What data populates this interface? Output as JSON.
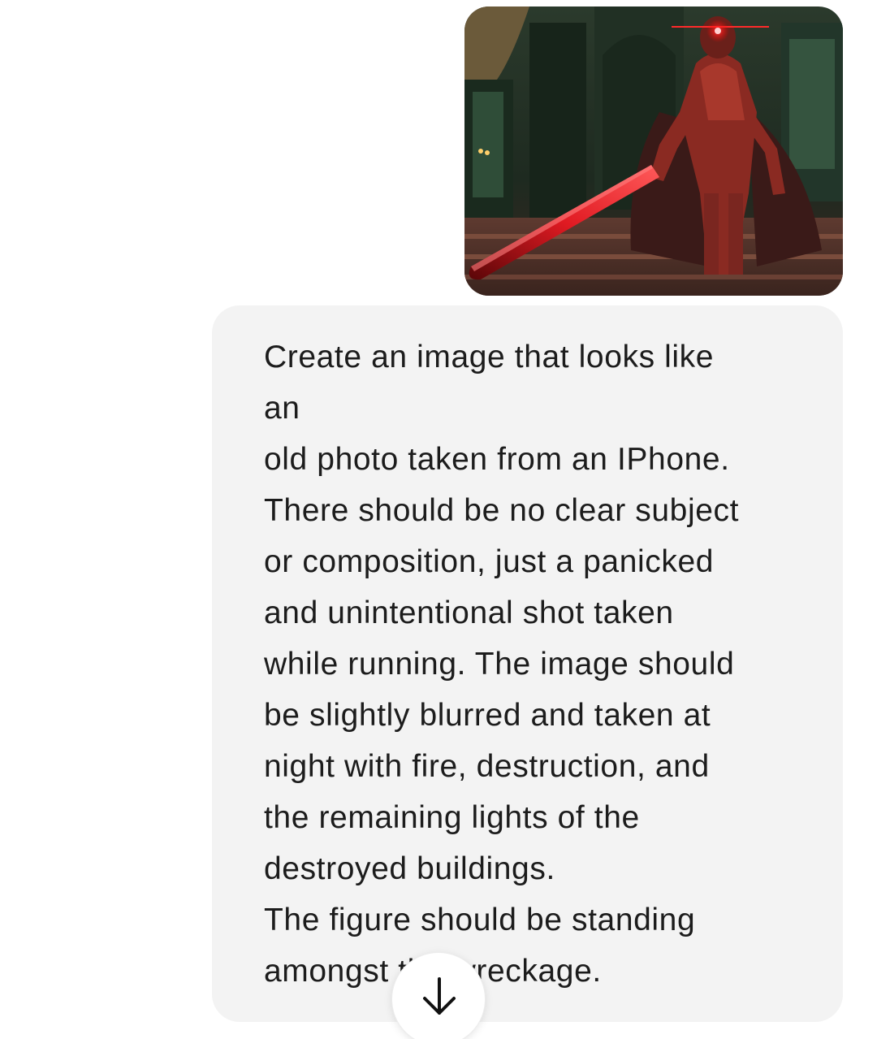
{
  "message": {
    "attachment_icon": "image-attachment",
    "lines": [
      "Create an image that looks like",
      "an",
      "old photo taken from an IPhone.",
      "There should be no clear subject",
      "or composition, just a panicked",
      "and unintentional shot taken",
      "while running. The image should",
      "be slightly blurred and taken at",
      "night with fire, destruction, and",
      "the remaining lights of the",
      "destroyed buildings.",
      "The figure should be standing",
      "amongst the wreckage."
    ]
  },
  "scroll_button": {
    "icon": "arrow-down-icon"
  },
  "colors": {
    "bubble_background": "#f3f3f3",
    "text": "#1c1c1c",
    "background": "#ffffff",
    "accent_red": "#d0141c"
  }
}
